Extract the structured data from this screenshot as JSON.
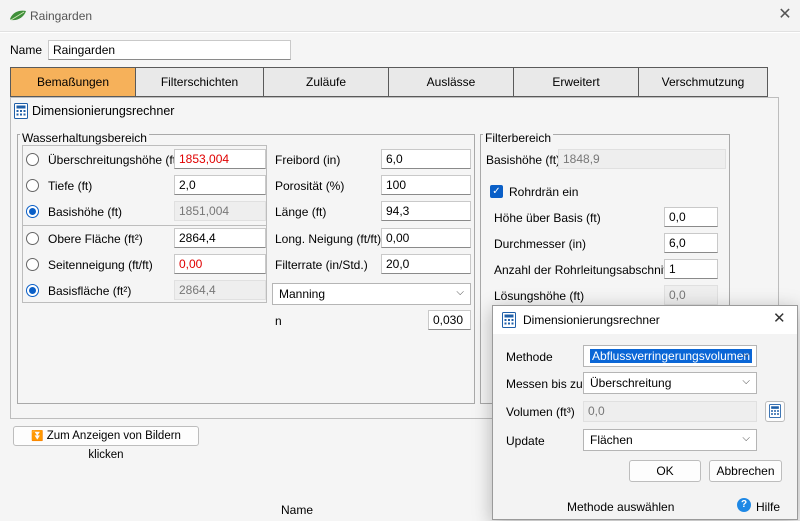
{
  "window": {
    "title": "Raingarden",
    "icon": "raingarden-leaf-icon",
    "close_icon": "close-icon"
  },
  "name_label": "Name",
  "name_value": "Raingarden",
  "tabs": [
    {
      "label": "Bemaßungen",
      "active": true
    },
    {
      "label": "Filterschichten"
    },
    {
      "label": "Zuläufe"
    },
    {
      "label": "Auslässe"
    },
    {
      "label": "Erweitert"
    },
    {
      "label": "Verschmutzung"
    }
  ],
  "section_title": "Dimensionierungsrechner",
  "section_icon": "calculator-icon",
  "retention": {
    "title": "Wasserhaltungsbereich",
    "rows": [
      {
        "label": "Überschreitungshöhe (ft)",
        "value": "1853,004",
        "selected": false,
        "red": true
      },
      {
        "label": "Tiefe (ft)",
        "value": "2,0",
        "selected": false
      },
      {
        "label": "Basishöhe (ft)",
        "value": "1851,004",
        "selected": true,
        "readonly": true
      },
      {
        "label": "Obere Fläche (ft²)",
        "value": "2864,4",
        "selected": false
      },
      {
        "label": "Seitenneigung (ft/ft)",
        "value": "0,00",
        "selected": false,
        "red": true
      },
      {
        "label": "Basisfläche (ft²)",
        "value": "2864,4",
        "selected": true,
        "readonly": true
      }
    ],
    "right_rows": [
      {
        "label": "Freibord (in)",
        "value": "6,0"
      },
      {
        "label": "Porosität (%)",
        "value": "100"
      },
      {
        "label": "Länge (ft)",
        "value": "94,3"
      },
      {
        "label": "Long. Neigung (ft/ft)",
        "value": "0,00"
      },
      {
        "label": "Filterrate (in/Std.)",
        "value": "20,0"
      }
    ],
    "method_value": "Manning",
    "n_label": "n",
    "n_value": "0,030"
  },
  "filter": {
    "title": "Filterbereich",
    "base_label": "Basishöhe (ft)",
    "base_value": "1848,9",
    "checkbox_label": "Rohrdrän ein",
    "checkbox_checked": true,
    "rows": [
      {
        "label": "Höhe über Basis (ft)",
        "value": "0,0"
      },
      {
        "label": "Durchmesser (in)",
        "value": "6,0"
      },
      {
        "label": "Anzahl der Rohrleitungsabschnitte",
        "value": "1"
      },
      {
        "label": "Lösungshöhe (ft)",
        "value": "0,0"
      }
    ]
  },
  "show_images_button": "Zum Anzeigen von Bildern klicken",
  "footer_name": "Name",
  "dialog": {
    "title": "Dimensionierungsrechner",
    "method_label": "Methode",
    "method_value": "Abflussverringerungsvolumen",
    "measure_label": "Messen bis zu",
    "measure_value": "Überschreitung",
    "volume_label": "Volumen (ft³)",
    "volume_value": "0,0",
    "update_label": "Update",
    "update_value": "Flächen",
    "ok": "OK",
    "cancel": "Abbrechen",
    "status": "Methode auswählen",
    "help": "Hilfe",
    "accent": "#0a66d6"
  }
}
